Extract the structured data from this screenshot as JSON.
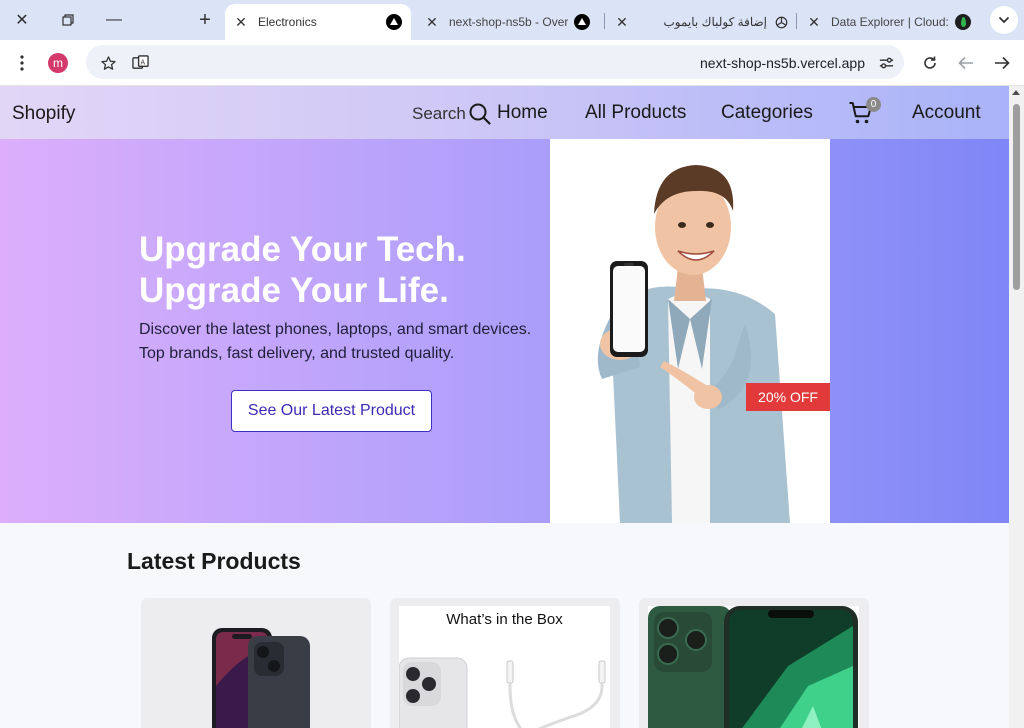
{
  "browser": {
    "tabs": [
      {
        "label": "Electronics",
        "active": true,
        "icon": "vercel-icon"
      },
      {
        "label": "next-shop-ns5b - Over",
        "active": false,
        "icon": "vercel-icon"
      },
      {
        "label": "إضافة كولباك بايموب",
        "active": false,
        "icon": "openai-icon"
      },
      {
        "label": "Data Explorer | Cloud:",
        "active": false,
        "icon": "mongodb-icon"
      }
    ],
    "profile_initial": "m",
    "url": "next-shop-ns5b.vercel.app"
  },
  "site": {
    "brand": "Shopify",
    "nav": {
      "search_label": "Search",
      "links": [
        "Home",
        "All Products",
        "Categories"
      ],
      "cart_count": "0",
      "account_label": "Account"
    },
    "hero": {
      "title_line1": "Upgrade Your Tech.",
      "title_line2": "Upgrade Your Life.",
      "subtitle": "Discover the latest phones, laptops, and smart devices. Top brands, fast delivery, and trusted quality.",
      "cta": "See Our Latest Product",
      "badge": "20% OFF"
    },
    "latest": {
      "title": "Latest Products",
      "box_caption": "What’s in the Box"
    }
  },
  "colors": {
    "accent": "#3a2bb5",
    "badge": "#e23a3a",
    "hero_start": "#dcaefb",
    "hero_end": "#7f86f6"
  }
}
